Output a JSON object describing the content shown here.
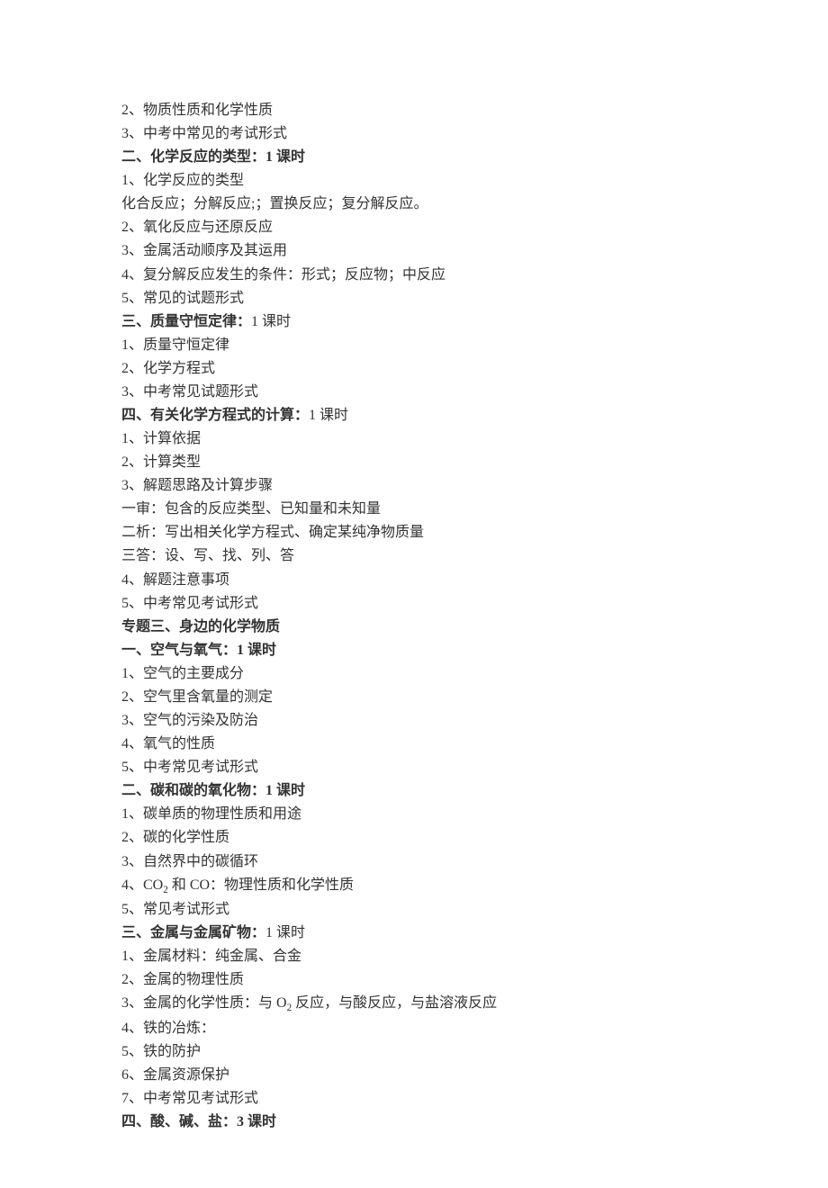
{
  "lines": [
    {
      "text": "2、物质性质和化学性质",
      "bold": false
    },
    {
      "text": "3、中考中常见的考试形式",
      "bold": false
    },
    {
      "text": "二、化学反应的类型：1 课时",
      "bold": true,
      "trailing_normal": ""
    },
    {
      "text": "1、化学反应的类型",
      "bold": false
    },
    {
      "text": "化合反应；分解反应;；置换反应；复分解反应。",
      "bold": false
    },
    {
      "text": "2、氧化反应与还原反应",
      "bold": false
    },
    {
      "text": "3、金属活动顺序及其运用",
      "bold": false
    },
    {
      "text": "4、复分解反应发生的条件：形式；反应物；中反应",
      "bold": false
    },
    {
      "text": "5、常见的试题形式",
      "bold": false
    },
    {
      "text_bold": "三、质量守恒定律：",
      "text_normal": "1 课时",
      "mixed": true
    },
    {
      "text": "1、质量守恒定律",
      "bold": false
    },
    {
      "text": "2、化学方程式",
      "bold": false
    },
    {
      "text": "3、中考常见试题形式",
      "bold": false
    },
    {
      "text_bold": "四、有关化学方程式的计算：",
      "text_normal": "1 课时",
      "mixed": true
    },
    {
      "text": "1、计算依据",
      "bold": false
    },
    {
      "text": "2、计算类型",
      "bold": false
    },
    {
      "text": "3、解题思路及计算步骤",
      "bold": false
    },
    {
      "text": "一审：包含的反应类型、已知量和未知量",
      "bold": false
    },
    {
      "text": "二析：写出相关化学方程式、确定某纯净物质量",
      "bold": false
    },
    {
      "text": "三答：设、写、找、列、答",
      "bold": false
    },
    {
      "text": "4、解题注意事项",
      "bold": false
    },
    {
      "text": "5、中考常见考试形式",
      "bold": false
    },
    {
      "text": "专题三、身边的化学物质",
      "bold": true
    },
    {
      "text": "一、空气与氧气：1 课时",
      "bold": true
    },
    {
      "text": "1、空气的主要成分",
      "bold": false
    },
    {
      "text": "2、空气里含氧量的测定",
      "bold": false
    },
    {
      "text": "3、空气的污染及防治",
      "bold": false
    },
    {
      "text": "4、氧气的性质",
      "bold": false
    },
    {
      "text": "5、中考常见考试形式",
      "bold": false
    },
    {
      "text": "二、碳和碳的氧化物：1 课时",
      "bold": true
    },
    {
      "text": "1、碳单质的物理性质和用途",
      "bold": false
    },
    {
      "text": "2、碳的化学性质",
      "bold": false
    },
    {
      "text": "3、自然界中的碳循环",
      "bold": false
    },
    {
      "text": "4、CO₂ 和 CO：物理性质和化学性质",
      "bold": false,
      "chem": true
    },
    {
      "text": "5、常见考试形式",
      "bold": false
    },
    {
      "text_bold": "三、金属与金属矿物：",
      "text_normal": "1 课时",
      "mixed": true
    },
    {
      "text": "1、金属材料：纯金属、合金",
      "bold": false
    },
    {
      "text": "2、金属的物理性质",
      "bold": false
    },
    {
      "text": "3、金属的化学性质：与 O₂ 反应，与酸反应，与盐溶液反应",
      "bold": false,
      "chem2": true
    },
    {
      "text": "4、铁的冶炼：",
      "bold": false
    },
    {
      "text": "5、铁的防护",
      "bold": false
    },
    {
      "text": "6、金属资源保护",
      "bold": false
    },
    {
      "text": "7、中考常见考试形式",
      "bold": false
    },
    {
      "text": "四、酸、碱、盐：3 课时",
      "bold": true
    }
  ],
  "chem_line_co2": {
    "prefix": "4、CO",
    "sub": "2",
    "mid": " 和 CO：物理性质和化学性质"
  },
  "chem_line_o2": {
    "prefix": "3、金属的化学性质：与 O",
    "sub": "2",
    "suffix": " 反应，与酸反应，与盐溶液反应"
  }
}
